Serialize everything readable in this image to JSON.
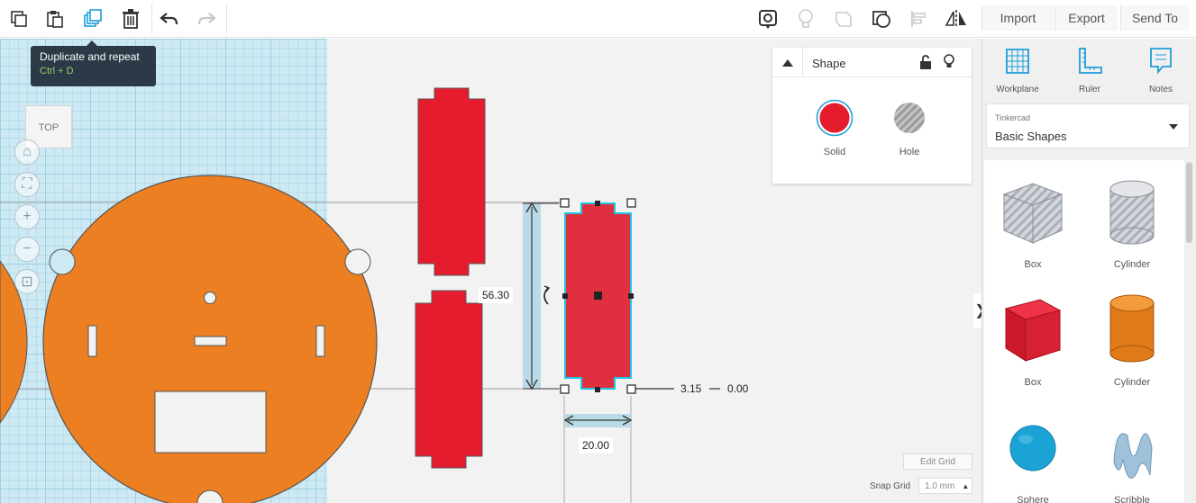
{
  "toolbar": {
    "icons": [
      "copy-icon",
      "paste-icon",
      "duplicate-icon",
      "trash-icon",
      "undo-icon",
      "redo-icon"
    ],
    "view_icons": [
      "camera-view-icon",
      "light-bulb-icon",
      "note-shape-icon",
      "group-icon",
      "align-icon",
      "mirror-icon"
    ],
    "import_label": "Import",
    "export_label": "Export",
    "send_to_label": "Send To"
  },
  "tooltip": {
    "title": "Duplicate and repeat",
    "shortcut": "Ctrl + D"
  },
  "view_cube": {
    "label": "TOP"
  },
  "shape_panel": {
    "title": "Shape",
    "solid_label": "Solid",
    "hole_label": "Hole",
    "solid_color": "#e51c2e"
  },
  "dimensions": {
    "height": "56.30",
    "width": "20.00",
    "offset": "3.15",
    "elevation": "0.00"
  },
  "grid": {
    "edit_label": "Edit Grid",
    "snap_label": "Snap Grid",
    "snap_value": "1.0 mm"
  },
  "right_panel": {
    "tools": [
      {
        "label": "Workplane",
        "icon": "workplane-icon"
      },
      {
        "label": "Ruler",
        "icon": "ruler-icon"
      },
      {
        "label": "Notes",
        "icon": "notes-icon"
      }
    ],
    "library_source": "Tinkercad",
    "library_name": "Basic Shapes",
    "shapes": [
      {
        "label": "Box"
      },
      {
        "label": "Cylinder"
      },
      {
        "label": "Box"
      },
      {
        "label": "Cylinder"
      },
      {
        "label": "Sphere"
      },
      {
        "label": "Scribble"
      }
    ]
  },
  "colors": {
    "accent": "#1e9ed9",
    "orange_part": "#ec7f22",
    "red_part": "#e51c2e",
    "grid_blue": "#cde9f3"
  }
}
